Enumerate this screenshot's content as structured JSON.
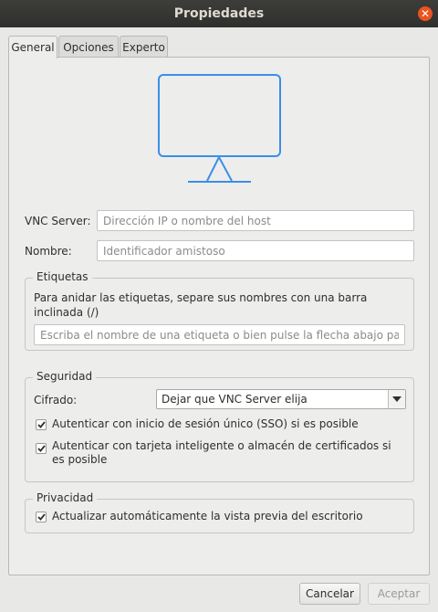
{
  "window": {
    "title": "Propiedades"
  },
  "icons": {
    "close": "close-icon",
    "monitor": "monitor-icon",
    "check": "checkmark-icon",
    "dropdown": "chevron-down-icon"
  },
  "colors": {
    "accent": "#3b8eea",
    "close_button": "#e95420"
  },
  "tabs": [
    {
      "label": "General",
      "active": true
    },
    {
      "label": "Opciones",
      "active": false
    },
    {
      "label": "Experto",
      "active": false
    }
  ],
  "general": {
    "vnc_server_label": "VNC Server:",
    "vnc_server_placeholder": "Dirección IP o nombre del host",
    "vnc_server_value": "",
    "nombre_label": "Nombre:",
    "nombre_placeholder": "Identificador amistoso",
    "nombre_value": ""
  },
  "etiquetas": {
    "title": "Etiquetas",
    "description": "Para anidar las etiquetas, separe sus nombres con una barra inclinada (/)",
    "input_placeholder": "Escriba el nombre de una etiqueta o bien pulse la flecha abajo para ap"
  },
  "seguridad": {
    "title": "Seguridad",
    "cifrado_label": "Cifrado:",
    "cifrado_value": "Dejar que VNC Server elija",
    "sso_label": "Autenticar con inicio de sesión único (SSO) si es posible",
    "sso_checked": true,
    "smartcard_label": "Autenticar con tarjeta inteligente o almacén de certificados si es posible",
    "smartcard_checked": true
  },
  "privacidad": {
    "title": "Privacidad",
    "preview_label": "Actualizar automáticamente la vista previa del escritorio",
    "preview_checked": true
  },
  "buttons": {
    "cancel": "Cancelar",
    "accept": "Aceptar"
  }
}
